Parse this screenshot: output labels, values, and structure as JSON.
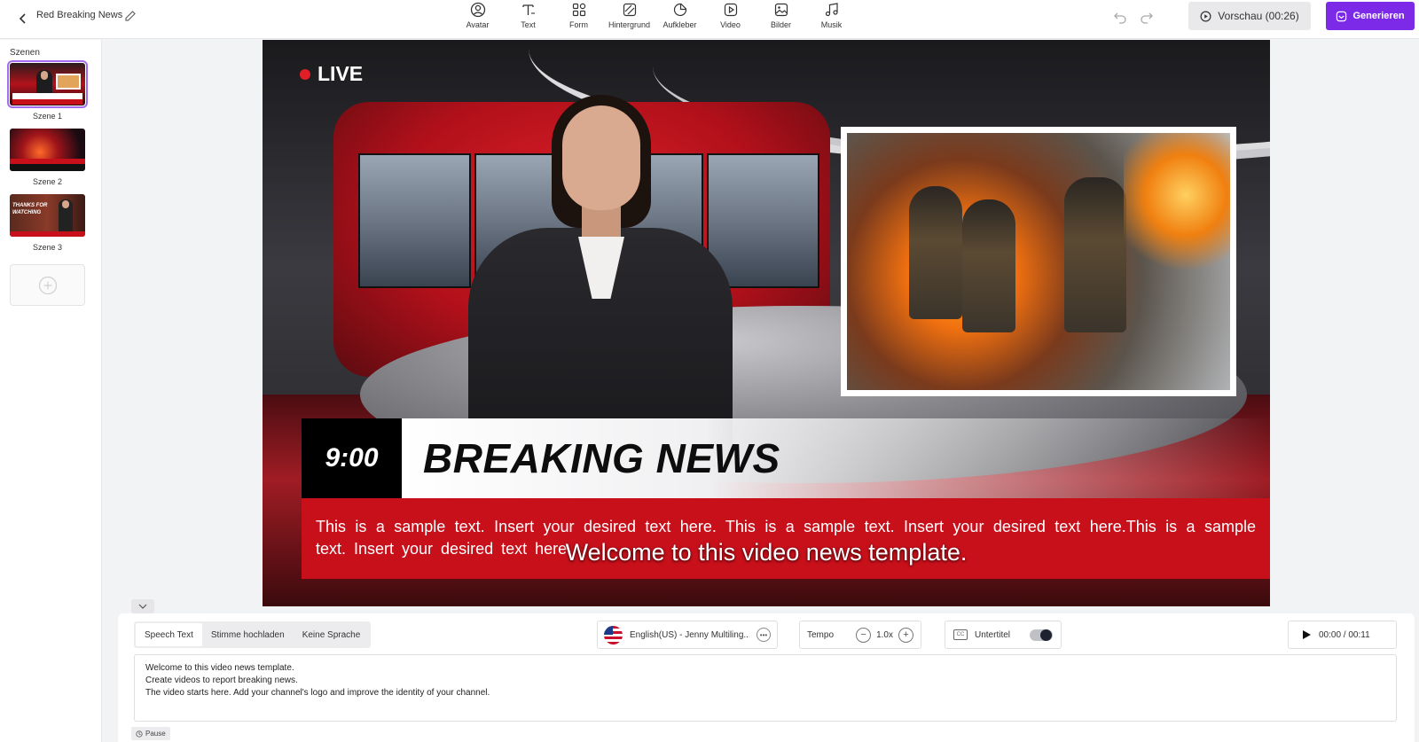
{
  "header": {
    "project_title": "Red Breaking News",
    "tools": [
      {
        "label": "Avatar",
        "icon": "avatar-icon"
      },
      {
        "label": "Text",
        "icon": "text-icon"
      },
      {
        "label": "Form",
        "icon": "shapes-icon"
      },
      {
        "label": "Hintergrund",
        "icon": "background-icon"
      },
      {
        "label": "Aufkleber",
        "icon": "sticker-icon"
      },
      {
        "label": "Video",
        "icon": "video-icon"
      },
      {
        "label": "Bilder",
        "icon": "image-icon"
      },
      {
        "label": "Musik",
        "icon": "music-icon"
      }
    ],
    "preview_label": "Vorschau (00:26)",
    "generate_label": "Generieren",
    "accent_color": "#7d2ae8"
  },
  "sidebar": {
    "title": "Szenen",
    "scenes": [
      {
        "label": "Szene 1",
        "active": true
      },
      {
        "label": "Szene 2",
        "active": false
      },
      {
        "label": "Szene 3",
        "active": false,
        "thumb_text": "THANKS FOR WATCHING"
      }
    ]
  },
  "canvas": {
    "live_label": "LIVE",
    "time": "9:00",
    "headline": "BREAKING NEWS",
    "ticker_text": "This is a sample text. Insert your desired text here. This is a sample text. Insert your desired text here.This is a sample text. Insert your desired text here.",
    "subtitle": "Welcome to this video news template.",
    "brand_red": "#c8101b"
  },
  "panel": {
    "tabs": [
      {
        "label": "Speech Text",
        "active": true
      },
      {
        "label": "Stimme hochladen",
        "active": false
      },
      {
        "label": "Keine Sprache",
        "active": false
      }
    ],
    "voice": "English(US) - Jenny Multiling...",
    "tempo_label": "Tempo",
    "tempo_value": "1.0x",
    "subtitles_label": "Untertitel",
    "subtitles_on": true,
    "playback": "00:00 / 00:11",
    "script_lines": [
      "Welcome to this video news template.",
      "Create videos to report breaking news.",
      "The video starts here. Add your channel's logo and improve the identity of your channel."
    ],
    "pause_label": "Pause"
  }
}
